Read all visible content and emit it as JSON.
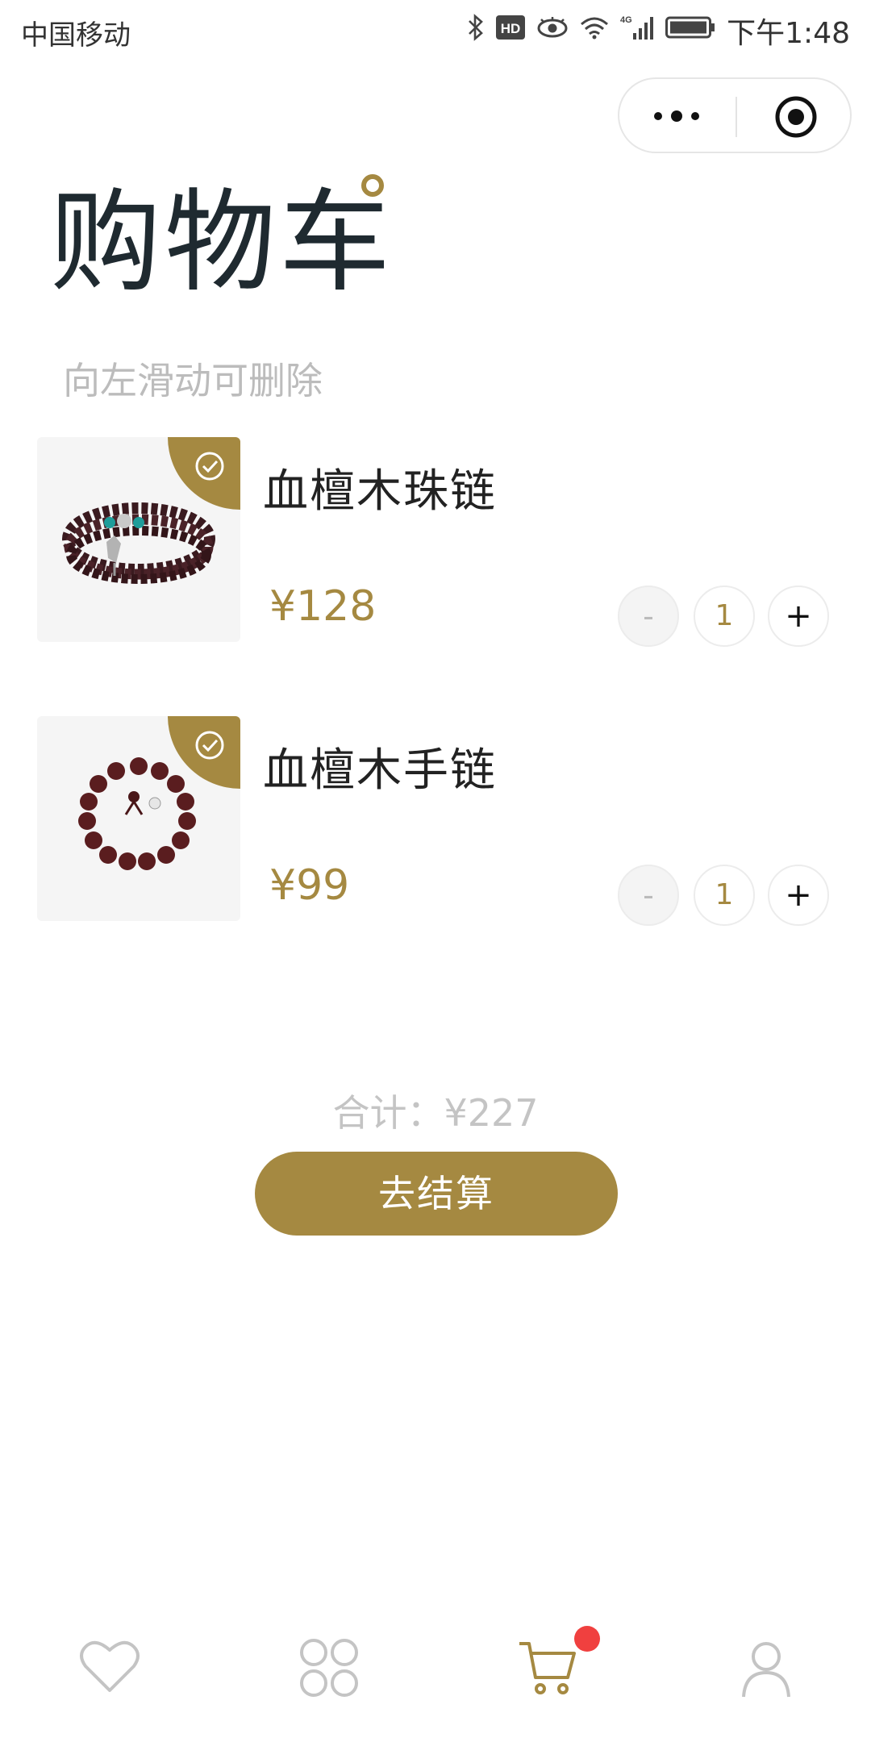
{
  "status_bar": {
    "carrier": "中国移动",
    "network": "4G",
    "hd_label": "HD",
    "time": "下午1:48"
  },
  "capsule": {
    "more_icon": "more-dots-icon",
    "close_icon": "target-circle-icon"
  },
  "header": {
    "title": "购物车",
    "hint": "向左滑动可删除"
  },
  "cart": {
    "items": [
      {
        "name": "血檀木珠链",
        "price": "¥128",
        "quantity": "1",
        "selected": true
      },
      {
        "name": "血檀木手链",
        "price": "¥99",
        "quantity": "1",
        "selected": true
      }
    ],
    "minus_label": "-",
    "plus_label": "+"
  },
  "summary": {
    "total": "合计：¥227",
    "checkout_label": "去结算"
  },
  "tabbar": {
    "tabs": [
      {
        "icon": "heart-icon",
        "active": false
      },
      {
        "icon": "grid-icon",
        "active": false
      },
      {
        "icon": "cart-icon",
        "active": true,
        "badge": true
      },
      {
        "icon": "user-icon",
        "active": false
      }
    ]
  },
  "colors": {
    "accent": "#a58941",
    "badge": "#f0403f",
    "title": "#1f2a30",
    "hint": "#bcbcbc"
  }
}
